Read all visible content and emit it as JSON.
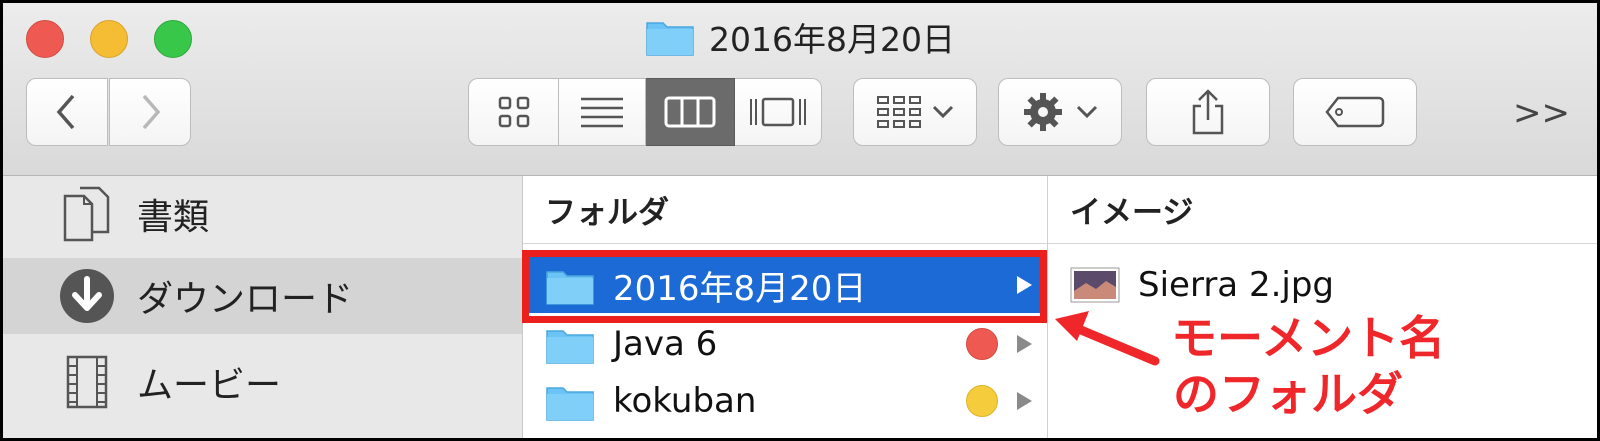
{
  "window": {
    "title": "2016年8月20日",
    "traffic_lights": {
      "close_color": "#ee5a52",
      "minimize_color": "#f5bd33",
      "zoom_color": "#39c74a"
    }
  },
  "toolbar": {
    "back_icon": "chevron-left-icon",
    "forward_icon": "chevron-right-icon",
    "view_modes": [
      "icon-view-icon",
      "list-view-icon",
      "column-view-icon",
      "cover-flow-view-icon"
    ],
    "active_view": "column",
    "group_icon": "arrange-grid-icon",
    "action_icon": "gear-icon",
    "share_icon": "share-icon",
    "tag_icon": "tag-icon",
    "overflow_label": ">>"
  },
  "sidebar": {
    "items": [
      {
        "label": "書類",
        "icon": "documents-icon",
        "selected": false
      },
      {
        "label": "ダウンロード",
        "icon": "downloads-icon",
        "selected": true
      },
      {
        "label": "ムービー",
        "icon": "movies-icon",
        "selected": false
      }
    ]
  },
  "columns": [
    {
      "header": "フォルダ",
      "rows": [
        {
          "name": "2016年8月20日",
          "selected": true,
          "tag_color": null,
          "has_children": true
        },
        {
          "name": "Java 6",
          "selected": false,
          "tag_color": "#ee5a52",
          "has_children": true
        },
        {
          "name": "kokuban",
          "selected": false,
          "tag_color": "#f5cc3b",
          "has_children": true
        }
      ]
    },
    {
      "header": "イメージ",
      "rows": [
        {
          "name": "Sierra 2.jpg",
          "icon": "image-thumbnail-icon"
        }
      ]
    }
  ],
  "annotation": {
    "line1": "モーメント名",
    "line2": "のフォルダ",
    "color": "#f0272a"
  },
  "colors": {
    "selection": "#1b6ad6",
    "folder": "#6cc3f5",
    "highlight_border": "#ec1f1f"
  }
}
